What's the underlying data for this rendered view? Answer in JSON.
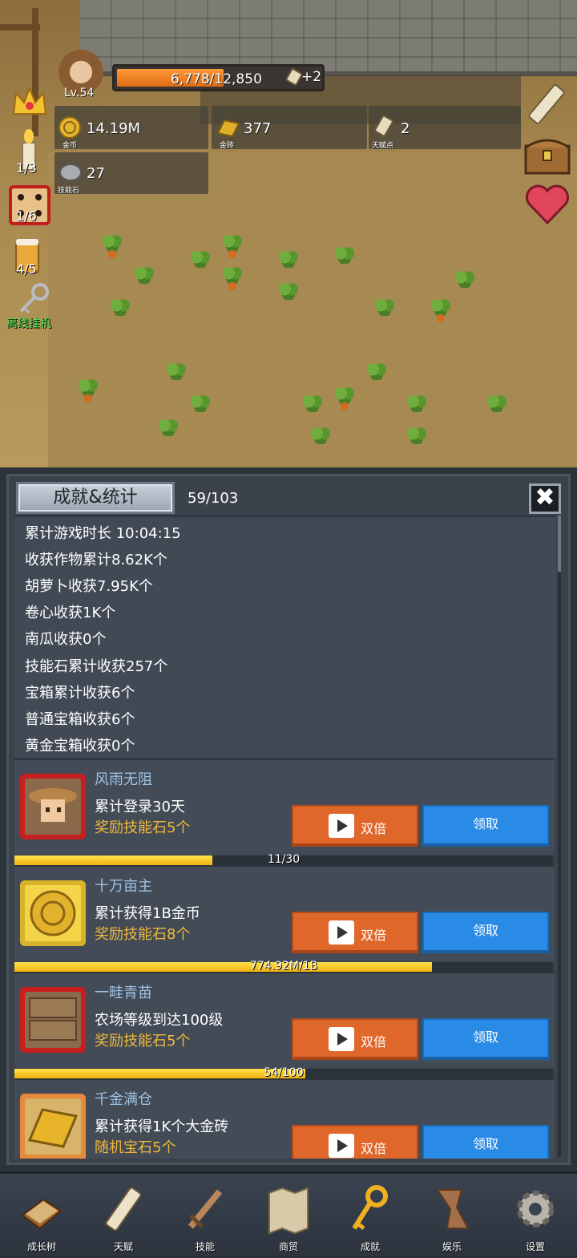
{
  "player": {
    "level": "Lv.54",
    "xp_text": "6,778/12,850",
    "xp_fraction": 0.527,
    "xp_bonus": "+2"
  },
  "resources": {
    "gold": {
      "value": "14.19M",
      "label": "金币"
    },
    "gold_brick": {
      "value": "377",
      "label": "金砖"
    },
    "talent_points": {
      "value": "2",
      "label": "天赋点"
    },
    "skill_stone": {
      "value": "27",
      "label": "技能石"
    }
  },
  "side": {
    "candle_count": "1/3",
    "dice_count": "1/6",
    "beer_count": "4/5",
    "afk_label": "离线挂机"
  },
  "panel": {
    "title": "成就&统计",
    "progress": "59/103",
    "close_symbol": "✖"
  },
  "stats": [
    "累计游戏时长 10:04:15",
    "收获作物累计8.62K个",
    "胡萝卜收获7.95K个",
    "卷心收获1K个",
    "南瓜收获0个",
    "技能石累计收获257个",
    "宝箱累计收获6个",
    "普通宝箱收获6个",
    "黄金宝箱收获0个"
  ],
  "achievements": [
    {
      "name": "风雨无阻",
      "desc": "累计登录30天",
      "reward": "奖励技能石5个",
      "double_label": "双倍",
      "claim_label": "领取",
      "progress_text": "11/30",
      "progress": 0.367
    },
    {
      "name": "十万亩主",
      "desc": "累计获得1B金币",
      "reward": "奖励技能石8个",
      "double_label": "双倍",
      "claim_label": "领取",
      "progress_text": "774.92M/1B",
      "progress": 0.775
    },
    {
      "name": "一畦青苗",
      "desc": "农场等级到达100级",
      "reward": "奖励技能石5个",
      "double_label": "双倍",
      "claim_label": "领取",
      "progress_text": "54/100",
      "progress": 0.54
    },
    {
      "name": "千金满仓",
      "desc": "累计获得1K个大金砖",
      "reward": "随机宝石5个",
      "double_label": "双倍",
      "claim_label": "领取"
    }
  ],
  "nav": [
    {
      "label": "成长树",
      "icon": "book-icon"
    },
    {
      "label": "天赋",
      "icon": "scroll-icon"
    },
    {
      "label": "技能",
      "icon": "sword-icon"
    },
    {
      "label": "商贸",
      "icon": "map-icon"
    },
    {
      "label": "成就",
      "icon": "key-icon"
    },
    {
      "label": "娱乐",
      "icon": "cloth-icon"
    },
    {
      "label": "设置",
      "icon": "gear-icon"
    }
  ],
  "colors": {
    "xp_fill": "#e8781c",
    "double_button": "#e0672a",
    "claim_button": "#2a8be6",
    "progress_fill": "#f6c31c",
    "achievement_name": "#9fc3e4",
    "reward_text": "#f0b83a"
  }
}
